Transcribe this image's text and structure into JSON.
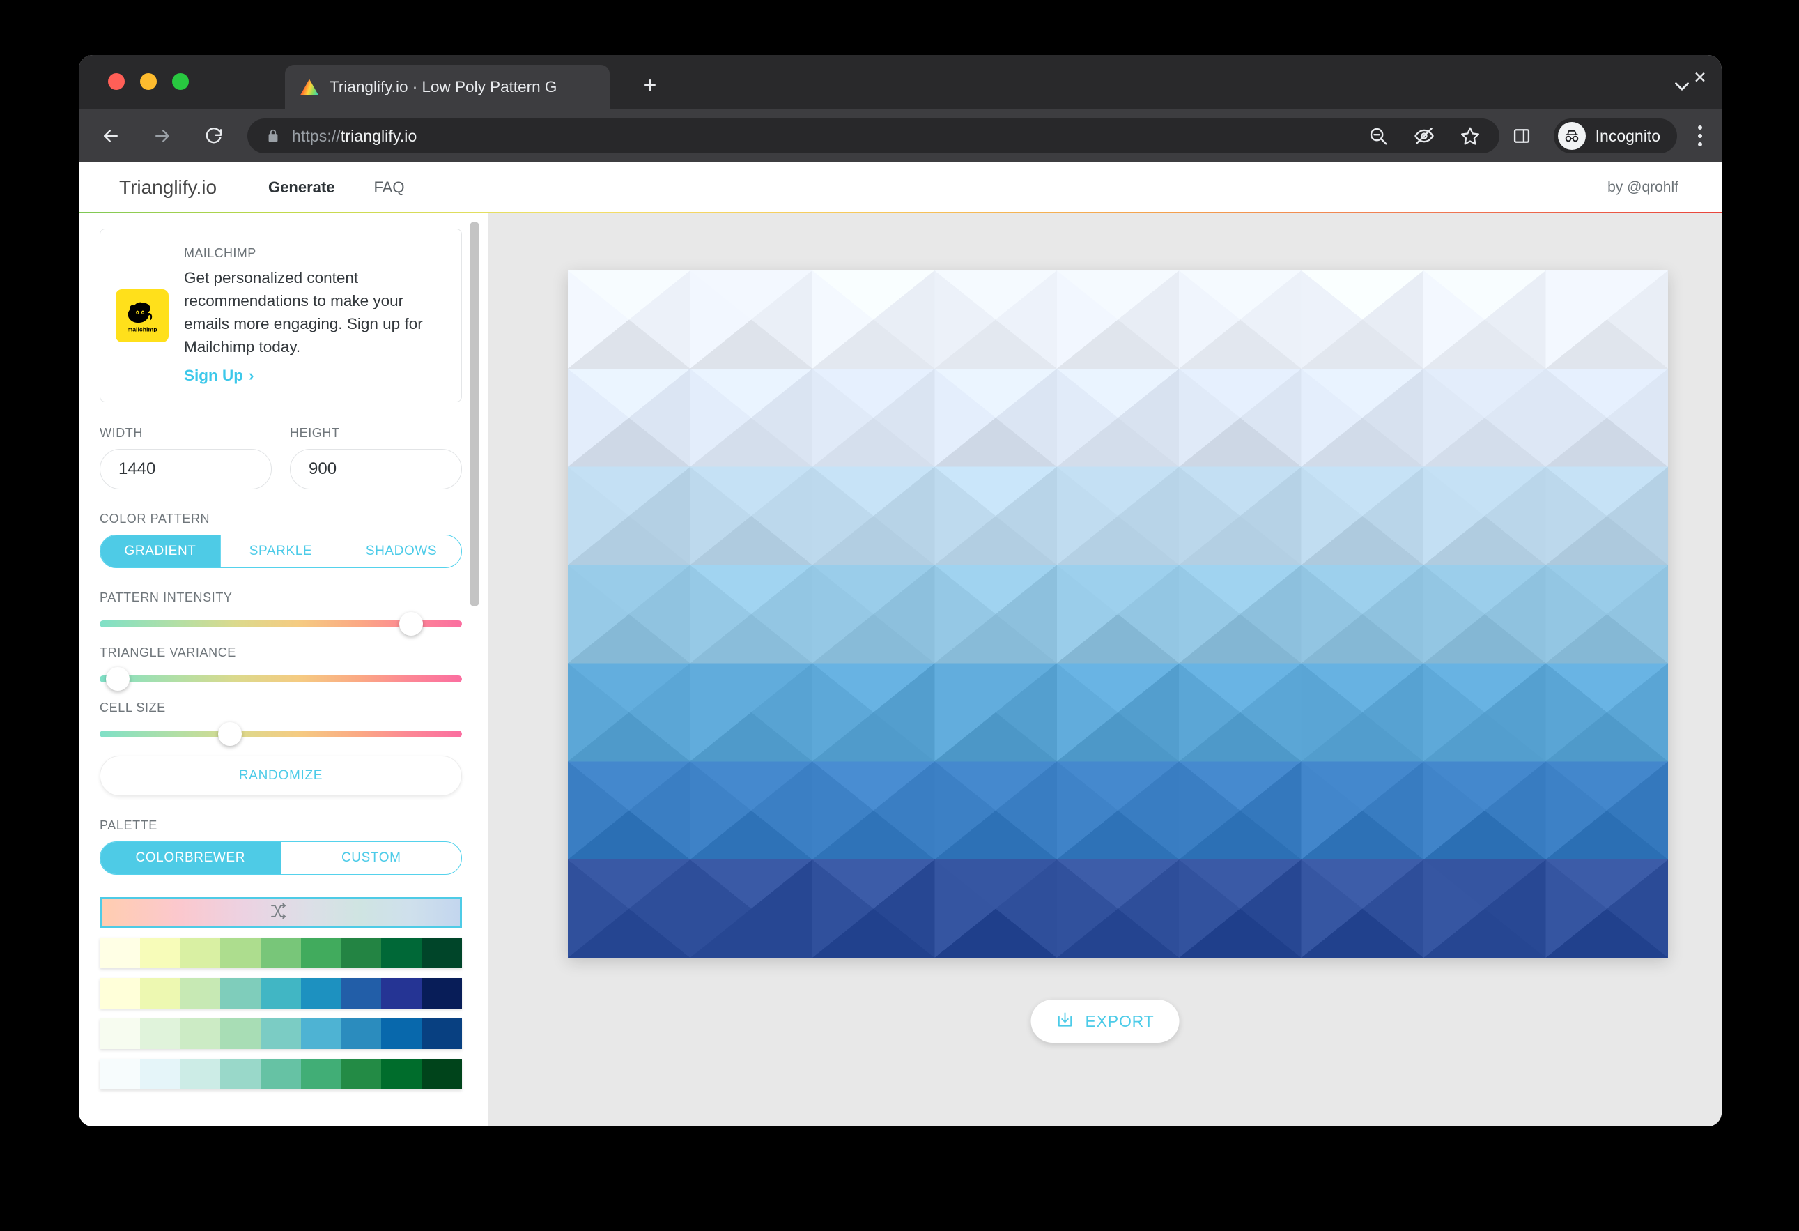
{
  "browser": {
    "tab": {
      "title": "Trianglify.io · Low Poly Pattern G",
      "favicon_name": "trianglify-triangle-icon",
      "close_label": "✕"
    },
    "new_tab_label": "+",
    "omnibox": {
      "scheme": "https://",
      "host": "trianglify.io",
      "full_url": "https://trianglify.io"
    },
    "profile": {
      "label": "Incognito"
    },
    "icons": {
      "back": "back-arrow-icon",
      "forward": "forward-arrow-icon",
      "reload": "reload-icon",
      "lock": "lock-icon",
      "zoom_out": "zoom-out-icon",
      "tracking_protection": "eye-off-icon",
      "bookmark": "star-icon",
      "side_panel": "side-panel-icon",
      "menu": "three-dot-menu-icon",
      "tab_list": "chevron-down-icon"
    }
  },
  "site": {
    "brand": "Trianglify.io",
    "nav": [
      {
        "label": "Generate",
        "active": true
      },
      {
        "label": "FAQ",
        "active": false
      }
    ],
    "byline": "by @qrohlf"
  },
  "ad": {
    "kicker": "MAILCHIMP",
    "body": "Get personalized content recommendations to make your emails more engaging. Sign up for Mailchimp today.",
    "cta": "Sign Up",
    "cta_chevron": "›",
    "logo_label": "mailchimp"
  },
  "controls": {
    "width": {
      "label": "WIDTH",
      "value": "1440"
    },
    "height": {
      "label": "HEIGHT",
      "value": "900"
    },
    "color_pattern": {
      "label": "COLOR PATTERN",
      "options": [
        "GRADIENT",
        "SPARKLE",
        "SHADOWS"
      ],
      "selected": "GRADIENT"
    },
    "pattern_intensity": {
      "label": "PATTERN INTENSITY",
      "value_pct": 86
    },
    "triangle_variance": {
      "label": "TRIANGLE VARIANCE",
      "value_pct": 5
    },
    "cell_size": {
      "label": "CELL SIZE",
      "value_pct": 36
    },
    "randomize_label": "RANDOMIZE",
    "palette": {
      "label": "PALETTE",
      "options": [
        "COLORBREWER",
        "CUSTOM"
      ],
      "selected": "COLORBREWER",
      "random_swatch_icon": "shuffle-icon",
      "swatches": [
        {
          "name": "YlGn",
          "colors": [
            "#ffffe5",
            "#f7fcb9",
            "#d9f0a3",
            "#addd8e",
            "#78c679",
            "#41ab5d",
            "#238443",
            "#006837",
            "#004529"
          ]
        },
        {
          "name": "YlGnBu",
          "colors": [
            "#ffffd9",
            "#edf8b1",
            "#c7e9b4",
            "#7fcdbb",
            "#41b6c4",
            "#1d91c0",
            "#225ea8",
            "#253494",
            "#081d58"
          ]
        },
        {
          "name": "GnBu",
          "colors": [
            "#f7fcf0",
            "#e0f3db",
            "#ccebc5",
            "#a8ddb5",
            "#7bccc4",
            "#4eb3d3",
            "#2b8cbe",
            "#0868ac",
            "#084081"
          ]
        },
        {
          "name": "BuGn",
          "colors": [
            "#f7fcfd",
            "#e5f5f9",
            "#ccece6",
            "#99d8c9",
            "#66c2a4",
            "#41ae76",
            "#238b45",
            "#006d2c",
            "#00441b"
          ]
        }
      ]
    }
  },
  "canvas": {
    "export_label": "EXPORT",
    "export_icon": "download-icon",
    "pattern": {
      "cols": 9,
      "rows": 7,
      "band_colors": [
        "#edf2fa",
        "#dde7f5",
        "#bcd8ec",
        "#93c6e3",
        "#5ba6d6",
        "#3b7fc4",
        "#2f4f9b"
      ],
      "accent_colors": [
        "#f6f9fd",
        "#cfdff2",
        "#a8cde7",
        "#74b2dc",
        "#4a92cd",
        "#3568b4",
        "#2a4688"
      ]
    }
  },
  "theme": {
    "accent": "#4ccbe8",
    "brand_yellow": "#ffe01b",
    "browser_chrome": "#3d3d40",
    "tabstrip": "#29292b",
    "canvas_bg": "#e8e8e8"
  }
}
